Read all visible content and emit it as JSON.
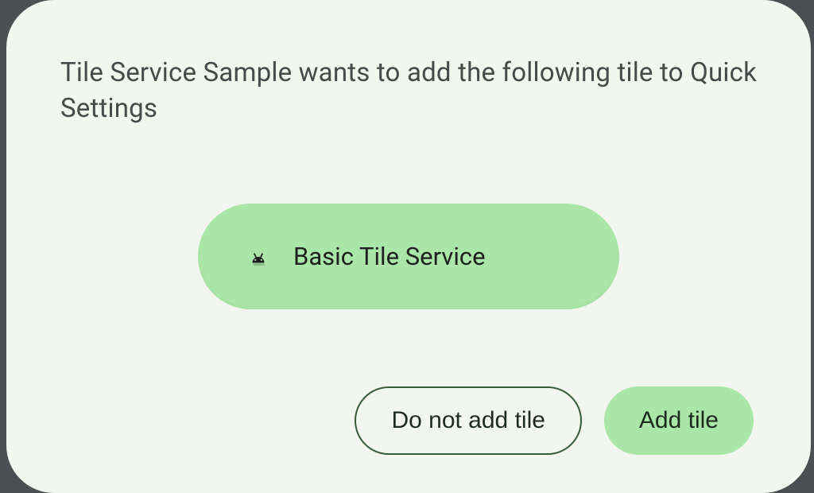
{
  "dialog": {
    "title": "Tile Service Sample wants to add the following tile to Quick Settings",
    "tile": {
      "icon": "android-icon",
      "label": "Basic Tile Service"
    },
    "buttons": {
      "deny": "Do not add tile",
      "allow": "Add tile"
    }
  },
  "colors": {
    "surface": "#f3f6ee",
    "accent": "#aae6a8",
    "outline": "#355b3b",
    "text": "#47494a"
  }
}
